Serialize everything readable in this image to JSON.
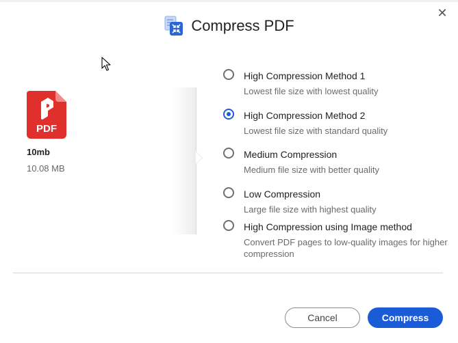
{
  "dialog": {
    "title": "Compress PDF",
    "close_symbol": "✕"
  },
  "file": {
    "name": "10mb",
    "size": "10.08 MB",
    "icon_label": "PDF",
    "icon": "pdf-file-icon"
  },
  "options": [
    {
      "title": "High Compression Method 1",
      "description": "Lowest file size with lowest quality",
      "selected": false
    },
    {
      "title": "High Compression Method 2",
      "description": "Lowest file size with standard quality",
      "selected": true
    },
    {
      "title": "Medium Compression",
      "description": "Medium file size with better quality",
      "selected": false
    },
    {
      "title": "Low Compression",
      "description": "Large file size with highest quality",
      "selected": false
    },
    {
      "title": "High Compression using Image method",
      "description": "Convert PDF pages to low-quality images for higher compression",
      "selected": false
    }
  ],
  "buttons": {
    "cancel": "Cancel",
    "compress": "Compress"
  },
  "colors": {
    "accent": "#1a5cd8",
    "pdf_red": "#e0302b"
  }
}
